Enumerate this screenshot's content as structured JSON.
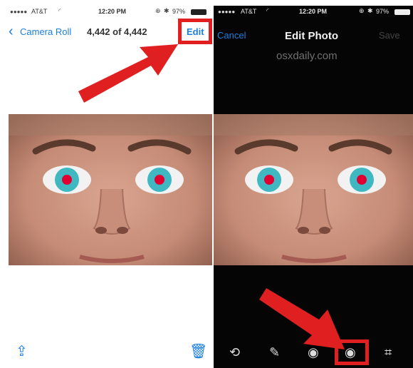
{
  "left": {
    "status": {
      "carrier": "AT&T",
      "time": "12:20 PM",
      "battery": "97%"
    },
    "nav": {
      "back_label": "Camera Roll",
      "counter": "4,442 of 4,442",
      "edit_label": "Edit"
    }
  },
  "right": {
    "status": {
      "carrier": "AT&T",
      "time": "12:20 PM",
      "battery": "97%"
    },
    "nav": {
      "cancel_label": "Cancel",
      "title": "Edit Photo",
      "save_label": "Save"
    },
    "watermark": "osxdaily.com"
  },
  "colors": {
    "accent": "#1a7fe0",
    "highlight": "#e02020",
    "dark_bg": "#050505"
  },
  "icons": {
    "left_toolbar": [
      "share-icon",
      "trash-icon"
    ],
    "right_toolbar": [
      "rotate-icon",
      "enhance-icon",
      "filters-icon",
      "red-eye-icon",
      "crop-icon"
    ]
  }
}
